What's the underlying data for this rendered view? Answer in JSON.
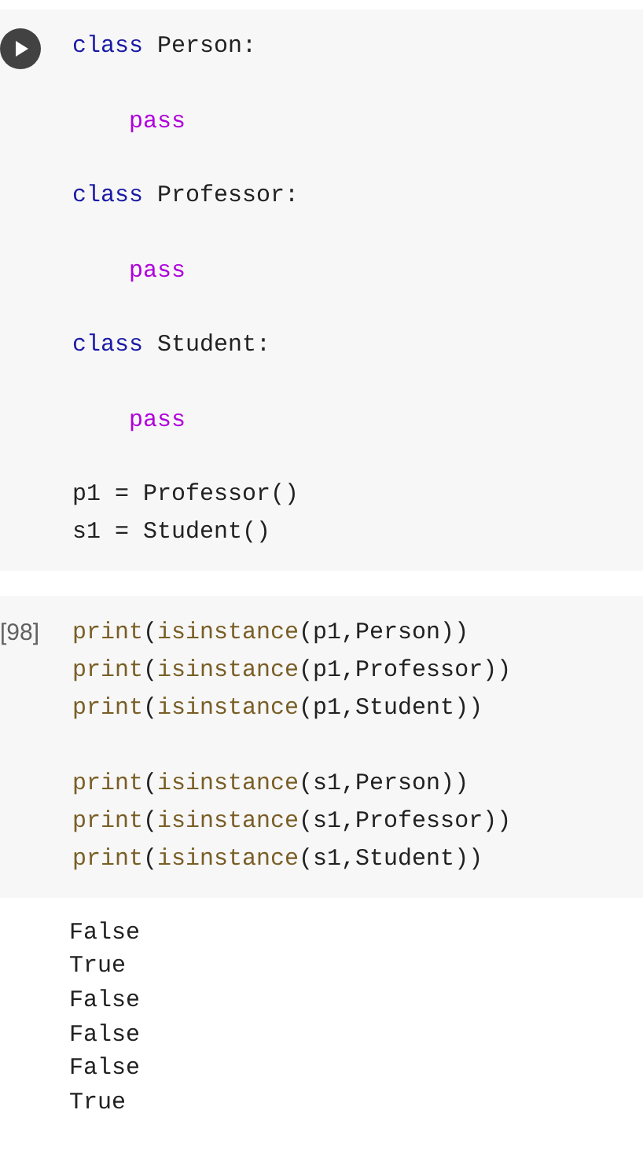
{
  "cells": [
    {
      "kind": "code",
      "run_button": true,
      "lines": [
        {
          "kind": "code",
          "indent": false,
          "tokens": [
            {
              "text": "class",
              "kind": "keyword"
            },
            {
              "text": " Person:",
              "kind": "plain"
            }
          ]
        },
        {
          "kind": "blank"
        },
        {
          "kind": "code",
          "indent": true,
          "tokens": [
            {
              "text": "pass",
              "kind": "control"
            }
          ]
        },
        {
          "kind": "blank"
        },
        {
          "kind": "code",
          "indent": false,
          "tokens": [
            {
              "text": "class",
              "kind": "keyword"
            },
            {
              "text": " Professor:",
              "kind": "plain"
            }
          ]
        },
        {
          "kind": "blank"
        },
        {
          "kind": "code",
          "indent": true,
          "tokens": [
            {
              "text": "pass",
              "kind": "control"
            }
          ]
        },
        {
          "kind": "blank"
        },
        {
          "kind": "code",
          "indent": false,
          "tokens": [
            {
              "text": "class",
              "kind": "keyword"
            },
            {
              "text": " Student:",
              "kind": "plain"
            }
          ]
        },
        {
          "kind": "blank"
        },
        {
          "kind": "code",
          "indent": true,
          "tokens": [
            {
              "text": "pass",
              "kind": "control"
            }
          ]
        },
        {
          "kind": "blank"
        },
        {
          "kind": "code",
          "indent": false,
          "tokens": [
            {
              "text": "p1 = Professor()",
              "kind": "plain"
            }
          ]
        },
        {
          "kind": "code",
          "indent": false,
          "tokens": [
            {
              "text": "s1 = Student()",
              "kind": "plain"
            }
          ]
        }
      ]
    },
    {
      "kind": "code",
      "execution_count": "[98]",
      "lines": [
        {
          "kind": "code",
          "indent": false,
          "tokens": [
            {
              "text": "print",
              "kind": "builtin"
            },
            {
              "text": "(",
              "kind": "plain"
            },
            {
              "text": "isinstance",
              "kind": "builtin"
            },
            {
              "text": "(p1,Person))",
              "kind": "plain"
            }
          ]
        },
        {
          "kind": "code",
          "indent": false,
          "tokens": [
            {
              "text": "print",
              "kind": "builtin"
            },
            {
              "text": "(",
              "kind": "plain"
            },
            {
              "text": "isinstance",
              "kind": "builtin"
            },
            {
              "text": "(p1,Professor))",
              "kind": "plain"
            }
          ]
        },
        {
          "kind": "code",
          "indent": false,
          "tokens": [
            {
              "text": "print",
              "kind": "builtin"
            },
            {
              "text": "(",
              "kind": "plain"
            },
            {
              "text": "isinstance",
              "kind": "builtin"
            },
            {
              "text": "(p1,Student))",
              "kind": "plain"
            }
          ]
        },
        {
          "kind": "blank"
        },
        {
          "kind": "code",
          "indent": false,
          "tokens": [
            {
              "text": "print",
              "kind": "builtin"
            },
            {
              "text": "(",
              "kind": "plain"
            },
            {
              "text": "isinstance",
              "kind": "builtin"
            },
            {
              "text": "(s1,Person))",
              "kind": "plain"
            }
          ]
        },
        {
          "kind": "code",
          "indent": false,
          "tokens": [
            {
              "text": "print",
              "kind": "builtin"
            },
            {
              "text": "(",
              "kind": "plain"
            },
            {
              "text": "isinstance",
              "kind": "builtin"
            },
            {
              "text": "(s1,Professor))",
              "kind": "plain"
            }
          ]
        },
        {
          "kind": "code",
          "indent": false,
          "tokens": [
            {
              "text": "print",
              "kind": "builtin"
            },
            {
              "text": "(",
              "kind": "plain"
            },
            {
              "text": "isinstance",
              "kind": "builtin"
            },
            {
              "text": "(s1,Student))",
              "kind": "plain"
            }
          ]
        }
      ],
      "output": [
        "False",
        "True",
        "False",
        "False",
        "False",
        "True"
      ]
    }
  ]
}
